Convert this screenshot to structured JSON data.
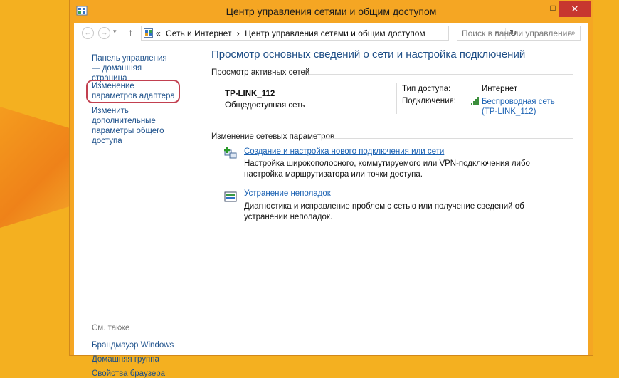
{
  "window": {
    "title": "Центр управления сетями и общим доступом",
    "minimize_glyph": "–",
    "maximize_glyph": "□",
    "close_glyph": "✕"
  },
  "address": {
    "back_glyph": "←",
    "forward_glyph": "→",
    "dropdown_glyph": "▾",
    "up_glyph": "↑",
    "prefix": "«",
    "crumbs": [
      "Сеть и Интернет",
      "›",
      "Центр управления сетями и общим доступом"
    ],
    "refresh_glyph": "↻",
    "search_placeholder": "Поиск в панели управления",
    "search_glyph": "⌕"
  },
  "left": {
    "home": "Панель управления — домашняя страница",
    "adapter": "Изменение параметров адаптера",
    "sharing": "Изменить дополнительные параметры общего доступа",
    "see_also": "См. также",
    "see_also_items": [
      "Брандмауэр Windows",
      "Домашняя группа",
      "Свойства браузера"
    ]
  },
  "main": {
    "title": "Просмотр основных сведений о сети и настройка подключений",
    "active_networks": "Просмотр активных сетей",
    "network": {
      "name": "TP-LINK_112",
      "category": "Общедоступная сеть",
      "access_label": "Тип доступа:",
      "access_value": "Интернет",
      "connections_label": "Подключения:",
      "connection_value": "Беспроводная сеть (TP-LINK_112)"
    },
    "change_settings": "Изменение сетевых параметров",
    "tasks": [
      {
        "title": "Создание и настройка нового подключения или сети",
        "desc": "Настройка широкополосного, коммутируемого или VPN-подключения либо настройка маршрутизатора или точки доступа."
      },
      {
        "title": "Устранение неполадок",
        "desc": "Диагностика и исправление проблем с сетью или получение сведений об устранении неполадок."
      }
    ]
  },
  "colors": {
    "desktop": "#f4b020",
    "link": "#1b4f8a",
    "highlight": "#c24050",
    "close_button": "#c7372f"
  }
}
